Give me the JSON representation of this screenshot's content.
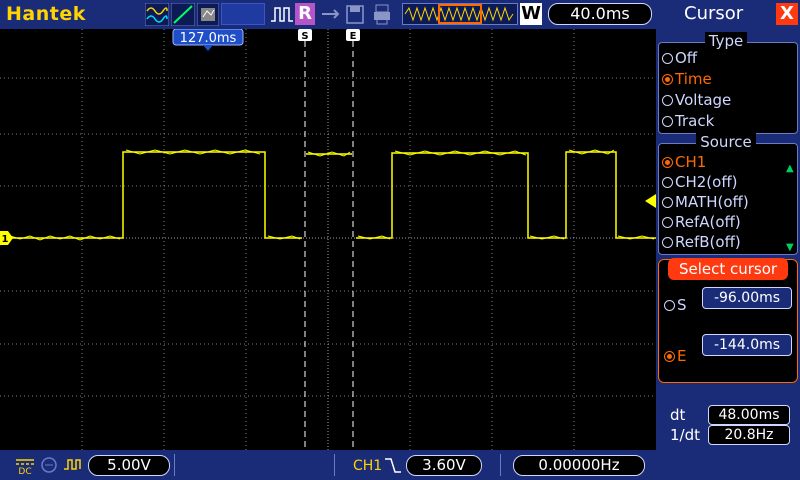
{
  "toolbar": {
    "brand": "Hantek",
    "trigger_mode_label": "R",
    "memory_label": "W",
    "timebase": "40.0ms"
  },
  "waveform": {
    "trigger_position_label": "127.0ms",
    "cursor_s_label": "S",
    "cursor_e_label": "E",
    "channel_marker": "1",
    "colors": {
      "trace": "#ffff00",
      "grid": "#808080",
      "cursor": "#ffffff"
    }
  },
  "bottom": {
    "ch1_scale": "5.00V",
    "trigger_source": "CH1",
    "trigger_level": "3.60V",
    "frequency": "0.00000Hz"
  },
  "menu": {
    "title": "Cursor",
    "close_label": "X",
    "type": {
      "label": "Type",
      "options": [
        {
          "label": "Off",
          "selected": false
        },
        {
          "label": "Time",
          "selected": true
        },
        {
          "label": "Voltage",
          "selected": false
        },
        {
          "label": "Track",
          "selected": false
        }
      ]
    },
    "source": {
      "label": "Source",
      "options": [
        {
          "label": "CH1",
          "selected": true
        },
        {
          "label": "CH2(off)",
          "selected": false
        },
        {
          "label": "MATH(off)",
          "selected": false
        },
        {
          "label": "RefA(off)",
          "selected": false
        },
        {
          "label": "RefB(off)",
          "selected": false
        }
      ]
    },
    "select_cursor": {
      "label": "Select cursor",
      "s_label": "S",
      "s_value": "-96.00ms",
      "e_label": "E",
      "e_value": "-144.0ms"
    },
    "measurements": {
      "dt_label": "dt",
      "dt_value": "48.00ms",
      "inv_dt_label": "1/dt",
      "inv_dt_value": "20.8Hz"
    }
  }
}
